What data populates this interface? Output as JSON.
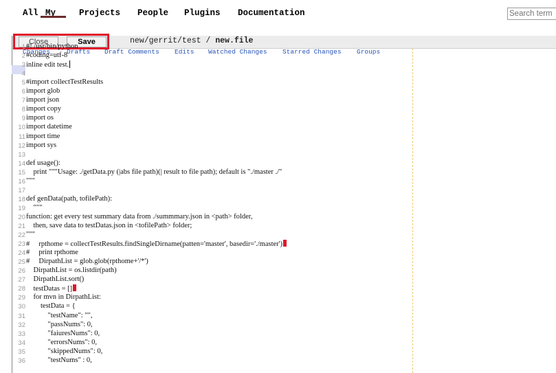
{
  "topnav": {
    "items": [
      "All",
      "My",
      "Projects",
      "People",
      "Plugins",
      "Documentation"
    ]
  },
  "search": {
    "placeholder": "Search term"
  },
  "subnav": {
    "items": [
      "Changes",
      "Drafts",
      "Draft Comments",
      "Edits",
      "Watched Changes",
      "Starred Changes",
      "Groups"
    ]
  },
  "editbar": {
    "close_label": "Close",
    "save_label": "Save",
    "path_prefix": "new/gerrit/test / ",
    "file_name": "new.file"
  },
  "code": {
    "lines": [
      {
        "n": "1",
        "t": "#! /usr/bin/python"
      },
      {
        "n": "2",
        "t": "#coding=utf-8"
      },
      {
        "n": "3",
        "t": "inline edit test."
      },
      {
        "n": "4",
        "t": ""
      },
      {
        "n": "5",
        "t": "#import collectTestResults"
      },
      {
        "n": "6",
        "t": "import glob"
      },
      {
        "n": "7",
        "t": "import json"
      },
      {
        "n": "8",
        "t": "import copy"
      },
      {
        "n": "9",
        "t": "import os"
      },
      {
        "n": "10",
        "t": "import datetime"
      },
      {
        "n": "11",
        "t": "import time"
      },
      {
        "n": "12",
        "t": "import sys"
      },
      {
        "n": "13",
        "t": ""
      },
      {
        "n": "14",
        "t": "def usage():"
      },
      {
        "n": "15",
        "t": "    print \"\"\"Usage: ./getData.py (|abs file path)(| result to file path); default is \"./master ./\""
      },
      {
        "n": "16",
        "t": "\"\"\""
      },
      {
        "n": "17",
        "t": ""
      },
      {
        "n": "18",
        "t": "def genData(path, tofilePath):"
      },
      {
        "n": "19",
        "t": "    \"\"\""
      },
      {
        "n": "20",
        "t": "function: get every test summary data from ./summmary.json in <path> folder,"
      },
      {
        "n": "21",
        "t": "    then, save data to testDatas.json in <tofilePath> folder;"
      },
      {
        "n": "22",
        "t": "\"\"\""
      },
      {
        "n": "23",
        "t": "#     rpthome = collectTestResults.findSingleDirname(patten='master', basedir='./master')"
      },
      {
        "n": "24",
        "t": "#     print rpthome"
      },
      {
        "n": "25",
        "t": "#     DirpathList = glob.glob(rpthome+'/*')"
      },
      {
        "n": "26",
        "t": "    DirpathList = os.listdir(path)"
      },
      {
        "n": "27",
        "t": "    DirpathList.sort()"
      },
      {
        "n": "28",
        "t": "    testDatas = []"
      },
      {
        "n": "29",
        "t": "    for mvn in DirpathList:"
      },
      {
        "n": "30",
        "t": "        testData = {"
      },
      {
        "n": "31",
        "t": "            \"testName\": \"\","
      },
      {
        "n": "32",
        "t": "            \"passNums\": 0,"
      },
      {
        "n": "33",
        "t": "            \"faiuresNums\": 0,"
      },
      {
        "n": "34",
        "t": "            \"errorsNums\": 0,"
      },
      {
        "n": "35",
        "t": "            \"skippedNums\": 0,"
      },
      {
        "n": "36",
        "t": "            \"testNums\" : 0,"
      }
    ]
  }
}
